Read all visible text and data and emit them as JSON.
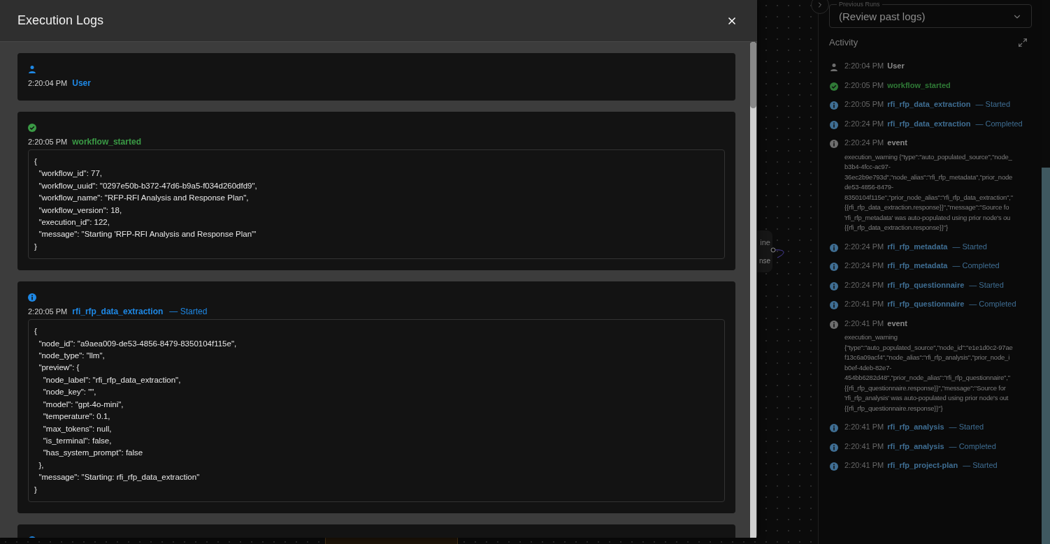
{
  "modal": {
    "title": "Execution Logs",
    "entries": [
      {
        "kind": "user",
        "time": "2:20:04 PM",
        "name": "User"
      },
      {
        "kind": "success",
        "time": "2:20:05 PM",
        "name": "workflow_started",
        "payload": "{\n  \"workflow_id\": 77,\n  \"workflow_uuid\": \"0297e50b-b372-47d6-b9a5-f034d260dfd9\",\n  \"workflow_name\": \"RFP-RFI Analysis and Response Plan\",\n  \"workflow_version\": 18,\n  \"execution_id\": 122,\n  \"message\": \"Starting 'RFP-RFI Analysis and Response Plan'\"\n}"
      },
      {
        "kind": "info",
        "time": "2:20:05 PM",
        "name": "rfi_rfp_data_extraction",
        "status": "— Started",
        "payload": "{\n  \"node_id\": \"a9aea009-de53-4856-8479-8350104f115e\",\n  \"node_type\": \"llm\",\n  \"preview\": {\n    \"node_label\": \"rfi_rfp_data_extraction\",\n    \"node_key\": \"\",\n    \"model\": \"gpt-4o-mini\",\n    \"temperature\": 0.1,\n    \"max_tokens\": null,\n    \"is_terminal\": false,\n    \"has_system_prompt\": false\n  },\n  \"message\": \"Starting: rfi_rfp_data_extraction\"\n}"
      },
      {
        "kind": "info"
      }
    ]
  },
  "canvas": {
    "node_texts": [
      "ine",
      "nse"
    ]
  },
  "sidebar": {
    "previous_runs": {
      "label": "Previous Runs",
      "value": "(Review past logs)"
    },
    "activity_title": "Activity",
    "items": [
      {
        "kind": "user",
        "time": "2:20:04 PM",
        "name": "User"
      },
      {
        "kind": "success",
        "time": "2:20:05 PM",
        "name": "workflow_started"
      },
      {
        "kind": "info",
        "time": "2:20:05 PM",
        "name": "rfi_rfp_data_extraction",
        "status": "— Started"
      },
      {
        "kind": "info",
        "time": "2:20:24 PM",
        "name": "rfi_rfp_data_extraction",
        "status": "— Completed"
      },
      {
        "kind": "event",
        "time": "2:20:24 PM",
        "name": "event",
        "detail": "execution_warning {\"type\":\"auto_populated_source\",\"node_\nb3b4-4fcc-ac97-\n36ec2b9e793d\",\"node_alias\":\"rfi_rfp_metadata\",\"prior_node\nde53-4856-8479-\n8350104f115e\",\"prior_node_alias\":\"rfi_rfp_data_extraction\",\"\n{{rfi_rfp_data_extraction.response}}\",\"message\":\"Source fo\n'rfi_rfp_metadata' was auto-populated using prior node's ou\n{{rfi_rfp_data_extraction.response}}\"}"
      },
      {
        "kind": "info",
        "time": "2:20:24 PM",
        "name": "rfi_rfp_metadata",
        "status": "— Started"
      },
      {
        "kind": "info",
        "time": "2:20:24 PM",
        "name": "rfi_rfp_metadata",
        "status": "— Completed"
      },
      {
        "kind": "info",
        "time": "2:20:24 PM",
        "name": "rfi_rfp_questionnaire",
        "status": "— Started"
      },
      {
        "kind": "info",
        "time": "2:20:41 PM",
        "name": "rfi_rfp_questionnaire",
        "status": "— Completed"
      },
      {
        "kind": "event",
        "time": "2:20:41 PM",
        "name": "event",
        "detail": "execution_warning\n{\"type\":\"auto_populated_source\",\"node_id\":\"e1e1d0c2-97ae\nf13c6a09acf4\",\"node_alias\":\"rfi_rfp_analysis\",\"prior_node_i\nb0ef-4deb-82e7-\n454bb6282d48\",\"prior_node_alias\":\"rfi_rfp_questionnaire\",\"\n{{rfi_rfp_questionnaire.response}}\",\"message\":\"Source for\n'rfi_rfp_analysis' was auto-populated using prior node's out\n{{rfi_rfp_questionnaire.response}}\"}"
      },
      {
        "kind": "info",
        "time": "2:20:41 PM",
        "name": "rfi_rfp_analysis",
        "status": "— Started"
      },
      {
        "kind": "info",
        "time": "2:20:41 PM",
        "name": "rfi_rfp_analysis",
        "status": "— Completed"
      },
      {
        "kind": "info",
        "time": "2:20:41 PM",
        "name": "rfi_rfp_project-plan",
        "status": "— Started"
      }
    ]
  }
}
